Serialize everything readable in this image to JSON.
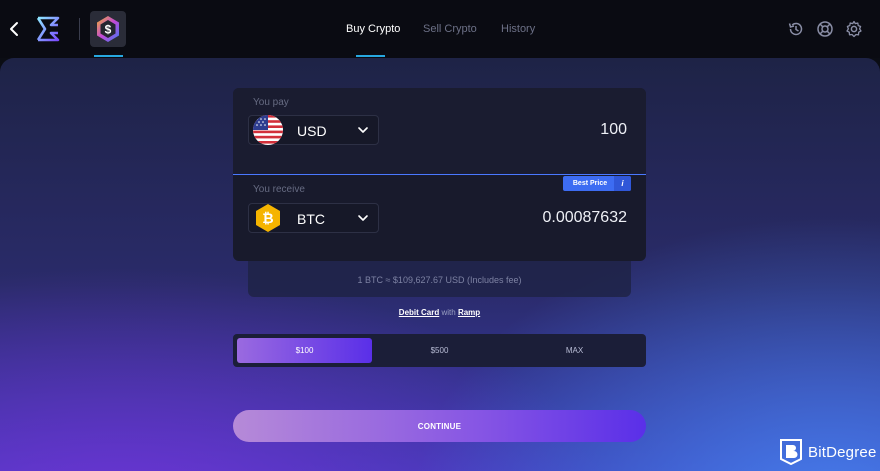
{
  "header": {
    "tabs": [
      {
        "label": "Buy Crypto",
        "active": true
      },
      {
        "label": "Sell Crypto",
        "active": false
      },
      {
        "label": "History",
        "active": false
      }
    ],
    "icons": [
      "back-arrow-icon",
      "exodus-logo-icon",
      "dollar-app-icon",
      "history-icon",
      "support-icon",
      "settings-icon"
    ]
  },
  "exchange": {
    "pay": {
      "label": "You pay",
      "currency": "USD",
      "amount": "100"
    },
    "receive": {
      "label": "You receive",
      "currency": "BTC",
      "amount": "0.00087632"
    },
    "best_price_label": "Best Price",
    "info_label": "i",
    "rate_text": "1 BTC ≈ $109,627.67 USD (Includes fee)"
  },
  "payment_method": {
    "method": "Debit Card",
    "connector": "with",
    "provider": "Ramp"
  },
  "presets": [
    {
      "label": "$100",
      "active": true
    },
    {
      "label": "$500",
      "active": false
    },
    {
      "label": "MAX",
      "active": false
    }
  ],
  "continue_label": "CONTINUE",
  "watermark": "BitDegree",
  "colors": {
    "accent": "#27a8e0",
    "divider": "#4a78ff",
    "best_price": "#3d6cf2",
    "preset_active_start": "#9a6ae0",
    "preset_active_end": "#5a2fe8"
  }
}
